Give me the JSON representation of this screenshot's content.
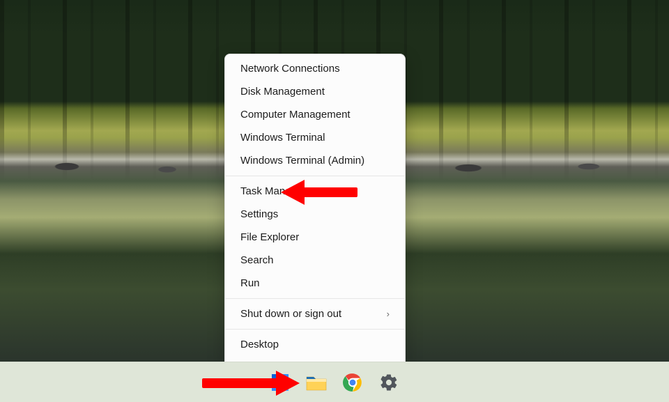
{
  "context_menu": {
    "groups": [
      [
        {
          "label": "Network Connections",
          "submenu": false,
          "id": "network-connections"
        },
        {
          "label": "Disk Management",
          "submenu": false,
          "id": "disk-management"
        },
        {
          "label": "Computer Management",
          "submenu": false,
          "id": "computer-management"
        },
        {
          "label": "Windows Terminal",
          "submenu": false,
          "id": "windows-terminal"
        },
        {
          "label": "Windows Terminal (Admin)",
          "submenu": false,
          "id": "windows-terminal-admin"
        }
      ],
      [
        {
          "label": "Task Manager",
          "submenu": false,
          "id": "task-manager"
        },
        {
          "label": "Settings",
          "submenu": false,
          "id": "settings"
        },
        {
          "label": "File Explorer",
          "submenu": false,
          "id": "file-explorer"
        },
        {
          "label": "Search",
          "submenu": false,
          "id": "search"
        },
        {
          "label": "Run",
          "submenu": false,
          "id": "run"
        }
      ],
      [
        {
          "label": "Shut down or sign out",
          "submenu": true,
          "id": "shut-down-or-sign-out"
        }
      ],
      [
        {
          "label": "Desktop",
          "submenu": false,
          "id": "desktop"
        }
      ]
    ]
  },
  "taskbar": {
    "items": [
      {
        "id": "start",
        "icon": "windows-logo-icon"
      },
      {
        "id": "file-explorer",
        "icon": "file-explorer-icon"
      },
      {
        "id": "chrome",
        "icon": "chrome-icon"
      },
      {
        "id": "settings",
        "icon": "settings-gear-icon"
      }
    ]
  },
  "annotations": {
    "arrow_to_settings_menu_item": true,
    "arrow_to_start_button": true
  },
  "colors": {
    "annotation_arrow": "#ff0000",
    "menu_bg": "#fcfcfc",
    "menu_text": "#1b1b1b",
    "taskbar_bg": "#dfe6d8"
  }
}
